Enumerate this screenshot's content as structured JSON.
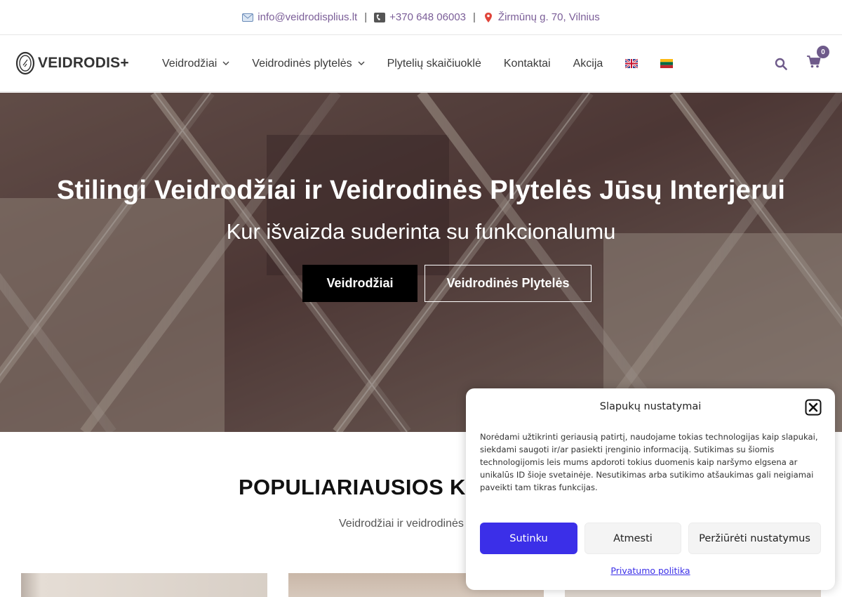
{
  "topbar": {
    "email": "info@veidrodisplius.lt",
    "separator": "|",
    "phone": "+370 648 06003",
    "address": "Žirmūnų g. 70, Vilnius"
  },
  "header": {
    "logo_text": "VEIDRODIS+",
    "nav": [
      {
        "label": "Veidrodžiai",
        "has_dropdown": true
      },
      {
        "label": "Veidrodinės plytelės",
        "has_dropdown": true
      },
      {
        "label": "Plytelių skaičiuoklė",
        "has_dropdown": false
      },
      {
        "label": "Kontaktai",
        "has_dropdown": false
      },
      {
        "label": "Akcija",
        "has_dropdown": false
      }
    ],
    "languages": [
      "english-flag-icon",
      "lithuanian-flag-icon"
    ],
    "cart_count": "0"
  },
  "hero": {
    "title": "Stilingi Veidrodžiai ir Veidrodinės Plytelės Jūsų Interjerui",
    "subtitle": "Kur išvaizda suderinta su funkcionalumu",
    "button_primary": "Veidrodžiai",
    "button_secondary": "Veidrodinės Plytelės"
  },
  "section": {
    "title": "POPULIARIAUSIOS K",
    "subtitle": "Veidrodžiai ir veidrodinės"
  },
  "cookie": {
    "title": "Slapukų nustatymai",
    "body": "Norėdami užtikrinti geriausią patirtį, naudojame tokias technologijas kaip slapukai, siekdami saugoti ir/ar pasiekti įrenginio informaciją. Sutikimas su šiomis technologijomis leis mums apdoroti tokius duomenis kaip naršymo elgsena ar unikalūs ID šioje svetainėje. Nesutikimas arba sutikimo atšaukimas gali neigiamai paveikti tam tikras funkcijas.",
    "accept": "Sutinku",
    "reject": "Atmesti",
    "preferences": "Peržiūrėti nustatymus",
    "privacy_link": "Privatumo politika"
  },
  "colors": {
    "accent_purple": "#7b5e98",
    "cookie_button": "#3b2fe8",
    "hero_button_dark": "#000000"
  }
}
